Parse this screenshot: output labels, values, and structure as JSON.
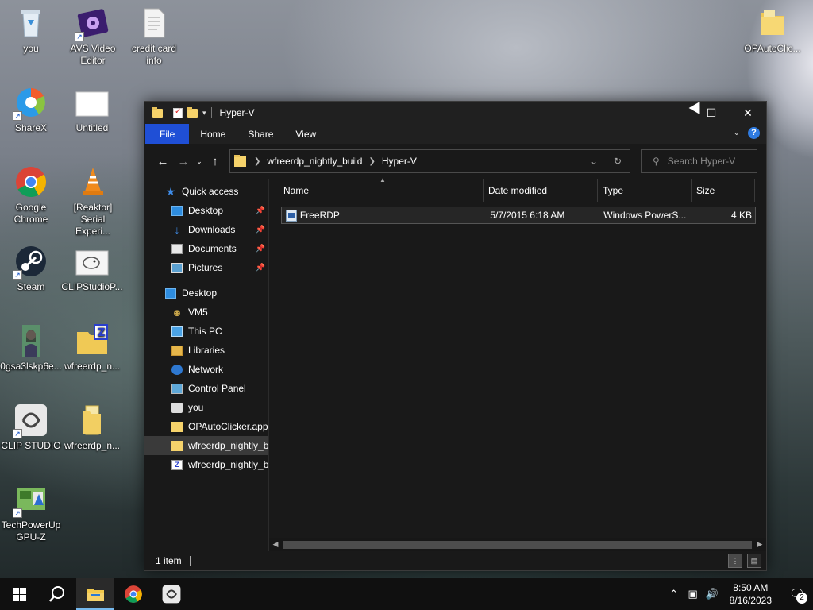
{
  "desktop": {
    "icons": [
      {
        "label": "you"
      },
      {
        "label": "AVS Video Editor"
      },
      {
        "label": "credit card info"
      },
      {
        "label": "OPAutoClic..."
      },
      {
        "label": "ShareX"
      },
      {
        "label": "Untitled"
      },
      {
        "label": "Google Chrome"
      },
      {
        "label": "[Reaktor] Serial Experi..."
      },
      {
        "label": "Steam"
      },
      {
        "label": "CLIPStudioP..."
      },
      {
        "label": "0gsa3lskp6e..."
      },
      {
        "label": "wfreerdp_n..."
      },
      {
        "label": "CLIP STUDIO"
      },
      {
        "label": "wfreerdp_n..."
      },
      {
        "label": "TechPowerUp GPU-Z"
      }
    ]
  },
  "window": {
    "title": "Hyper-V",
    "ribbon": {
      "tabs": [
        "File",
        "Home",
        "Share",
        "View"
      ],
      "help": "?"
    },
    "address": {
      "crumbs": [
        "wfreerdp_nightly_build",
        "Hyper-V"
      ]
    },
    "search": {
      "placeholder": "Search Hyper-V"
    },
    "nav_pane": {
      "quick_access": "Quick access",
      "quick_items": [
        "Desktop",
        "Downloads",
        "Documents",
        "Pictures"
      ],
      "tree": [
        "Desktop",
        "VM5",
        "This PC",
        "Libraries",
        "Network",
        "Control Panel",
        "you",
        "OPAutoClicker.app",
        "wfreerdp_nightly_build",
        "wfreerdp_nightly_build"
      ]
    },
    "columns": [
      "Name",
      "Date modified",
      "Type",
      "Size"
    ],
    "files": [
      {
        "name": "FreeRDP",
        "date": "5/7/2015 6:18 AM",
        "type": "Windows PowerS...",
        "size": "4 KB"
      }
    ],
    "status": {
      "count": "1 item"
    }
  },
  "taskbar": {
    "clock_time": "8:50 AM",
    "clock_date": "8/16/2023",
    "notification_count": "2"
  },
  "colors": {
    "accent": "#1f4fd6",
    "window_bg": "#191919",
    "taskbar_bg": "#101010"
  }
}
